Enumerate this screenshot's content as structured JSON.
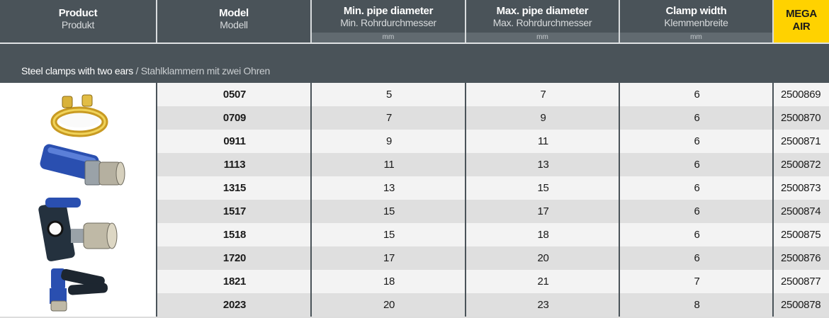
{
  "header": {
    "product": {
      "en": "Product",
      "de": "Produkt"
    },
    "model": {
      "en": "Model",
      "de": "Modell"
    },
    "min_diameter": {
      "en": "Min. pipe diameter",
      "de": "Min. Rohrdurchmesser",
      "unit": "mm"
    },
    "max_diameter": {
      "en": "Max. pipe diameter",
      "de": "Max. Rohrdurchmesser",
      "unit": "mm"
    },
    "clamp_width": {
      "en": "Clamp width",
      "de": "Klemmenbreite",
      "unit": "mm"
    },
    "brand": {
      "line1": "MEGA",
      "line2": "AIR"
    }
  },
  "category": {
    "en": "Steel clamps with two ears",
    "separator": "/",
    "de": "Stahlklammern mit zwei Ohren"
  },
  "rows": [
    {
      "model": "0507",
      "min": "5",
      "max": "7",
      "width": "6",
      "article": "2500869"
    },
    {
      "model": "0709",
      "min": "7",
      "max": "9",
      "width": "6",
      "article": "2500870"
    },
    {
      "model": "0911",
      "min": "9",
      "max": "11",
      "width": "6",
      "article": "2500871"
    },
    {
      "model": "1113",
      "min": "11",
      "max": "13",
      "width": "6",
      "article": "2500872"
    },
    {
      "model": "1315",
      "min": "13",
      "max": "15",
      "width": "6",
      "article": "2500873"
    },
    {
      "model": "1517",
      "min": "15",
      "max": "17",
      "width": "6",
      "article": "2500874"
    },
    {
      "model": "1518",
      "min": "15",
      "max": "18",
      "width": "6",
      "article": "2500875"
    },
    {
      "model": "1720",
      "min": "17",
      "max": "20",
      "width": "6",
      "article": "2500876"
    },
    {
      "model": "1821",
      "min": "18",
      "max": "21",
      "width": "7",
      "article": "2500877"
    },
    {
      "model": "2023",
      "min": "20",
      "max": "23",
      "width": "8",
      "article": "2500878"
    }
  ],
  "colors": {
    "header_bg": "#4a5359",
    "brand_bg": "#ffd200",
    "row_shade": "#dfdfdf",
    "row_plain": "#f3f3f3"
  }
}
